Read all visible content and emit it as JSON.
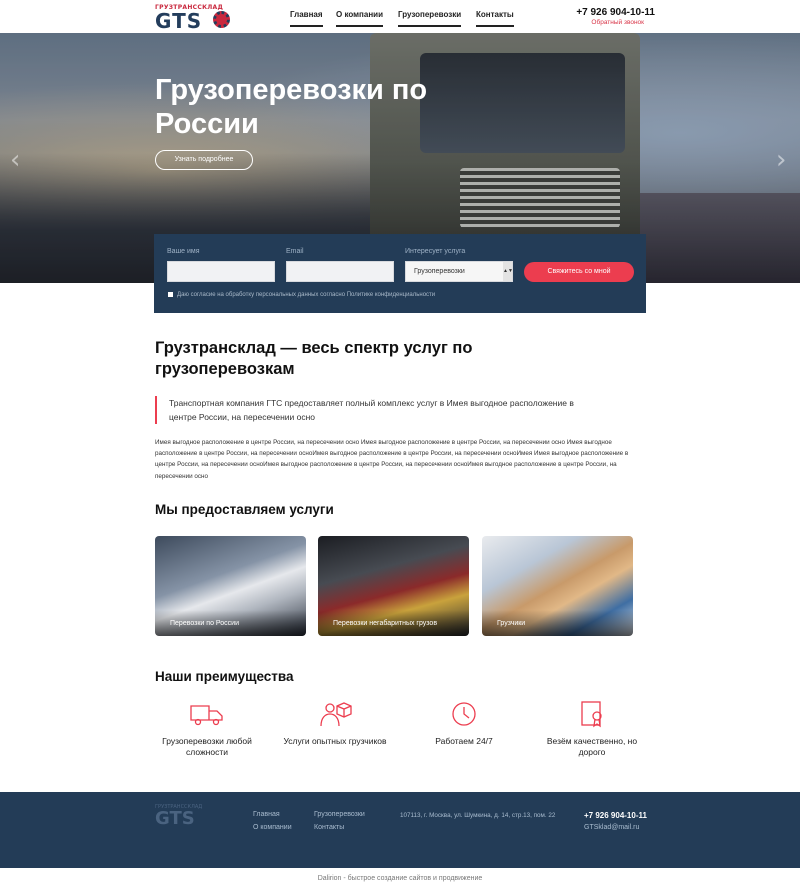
{
  "header": {
    "logo_tagline": "ГРУЗТРАНССКЛАД",
    "logo_text": "GTS",
    "nav": [
      "Главная",
      "О компании",
      "Грузоперевозки",
      "Контакты"
    ],
    "phone": "+7 926 904-10-11",
    "callback": "Обратный звонок"
  },
  "hero": {
    "title": "Грузоперевозки по России",
    "button": "Узнать подробнее",
    "prev_icon": "chevron-left",
    "next_icon": "chevron-right"
  },
  "form": {
    "name_label": "Ваше имя",
    "email_label": "Email",
    "service_label": "Интересует услуга",
    "service_value": "Грузоперевозки",
    "submit": "Свяжитесь со мной",
    "agree": "Даю согласие на обработку персональных данных согласно Политике конфиденциальности"
  },
  "intro": {
    "title": "Грузтрансклад — весь спектр услуг по грузоперевозкам",
    "quote": "Транспортная компания ГТС предоставляет полный комплекс услуг в Имея выгодное расположение в центре России, на пересечении осно",
    "body": "Имея выгодное расположение в центре России, на пересечении осно Имея выгодное расположение в центре России, на пересечении осно Имея выгодное расположение в центре России, на пересечении осноИмея выгодное расположение в центре России, на пересечении осноИмея Имея выгодное расположение в центре России, на пересечении осноИмея выгодное расположение в центре России, на пересечении осноИмея выгодное расположение в центре России, на пересечении осно"
  },
  "services": {
    "title": "Мы предоставляем услуги",
    "items": [
      "Перевозки по России",
      "Перевозки негабаритных грузов",
      "Грузчики"
    ]
  },
  "advantages": {
    "title": "Наши преимущества",
    "items": [
      {
        "label": "Грузоперевозки любой сложности",
        "icon": "truck-icon"
      },
      {
        "label": "Услуги опытных грузчиков",
        "icon": "loader-icon"
      },
      {
        "label": "Работаем 24/7",
        "icon": "clock-icon"
      },
      {
        "label": "Везём качественно, но дорого",
        "icon": "certificate-icon"
      }
    ]
  },
  "footer": {
    "logo_tagline": "ГРУЗТРАНССКЛАД",
    "logo_text": "GTS",
    "links_col1": [
      "Главная",
      "О компании"
    ],
    "links_col2": [
      "Грузоперевозки",
      "Контакты"
    ],
    "address": "107113, г. Москва, ул. Шумкина, д. 14, стр.13, пом. 22",
    "phone": "+7 926 904-10-11",
    "email": "GTSklad@mail.ru",
    "credit": "Dalirion - быстрое создание сайтов и продвижение"
  },
  "colors": {
    "accent": "#ec3d4f",
    "navy": "#233c57"
  }
}
